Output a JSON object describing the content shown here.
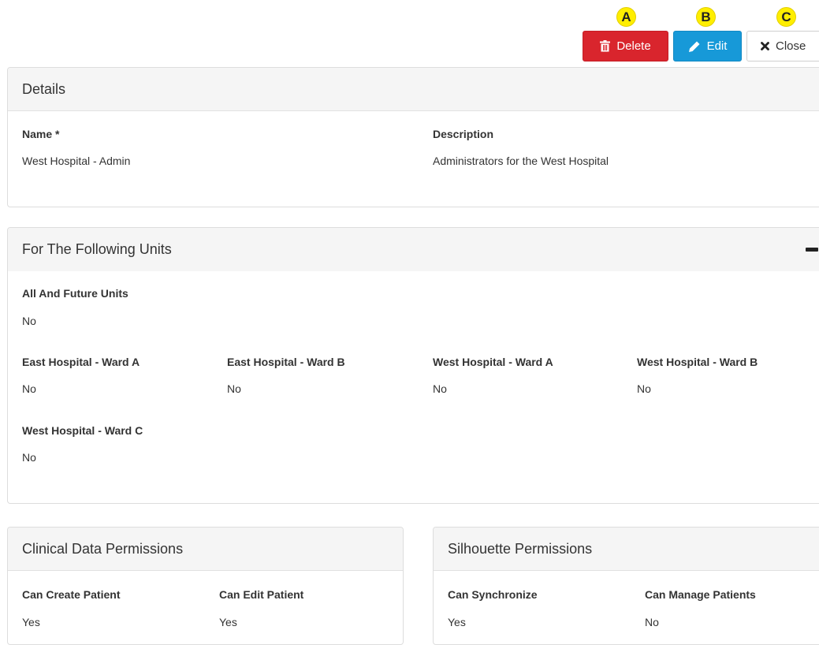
{
  "toolbar": {
    "delete": {
      "label": "Delete",
      "badge": "A"
    },
    "edit": {
      "label": "Edit",
      "badge": "B"
    },
    "close": {
      "label": "Close",
      "badge": "C"
    }
  },
  "details": {
    "title": "Details",
    "name_label": "Name *",
    "name_value": "West Hospital - Admin",
    "description_label": "Description",
    "description_value": "Administrators for the West Hospital"
  },
  "units": {
    "title": "For The Following Units",
    "all_future": {
      "label": "All And Future Units",
      "value": "No"
    },
    "items": [
      {
        "label": "East Hospital - Ward A",
        "value": "No"
      },
      {
        "label": "East Hospital - Ward B",
        "value": "No"
      },
      {
        "label": "West Hospital - Ward A",
        "value": "No"
      },
      {
        "label": "West Hospital - Ward B",
        "value": "No"
      },
      {
        "label": "West Hospital - Ward C",
        "value": "No"
      }
    ]
  },
  "clinical": {
    "title": "Clinical Data Permissions",
    "items": [
      {
        "label": "Can Create Patient",
        "value": "Yes"
      },
      {
        "label": "Can Edit Patient",
        "value": "Yes"
      }
    ]
  },
  "silhouette": {
    "title": "Silhouette Permissions",
    "items": [
      {
        "label": "Can Synchronize",
        "value": "Yes"
      },
      {
        "label": "Can Manage Patients",
        "value": "No"
      }
    ]
  },
  "icons": {
    "delete": "trash-icon",
    "edit": "pencil-icon",
    "close": "x-mark-icon",
    "collapse": "minus-icon"
  },
  "colors": {
    "delete_button": "#d9252d",
    "edit_button": "#1799d8",
    "badge": "#ffee00",
    "panel_heading": "#f5f5f5"
  }
}
